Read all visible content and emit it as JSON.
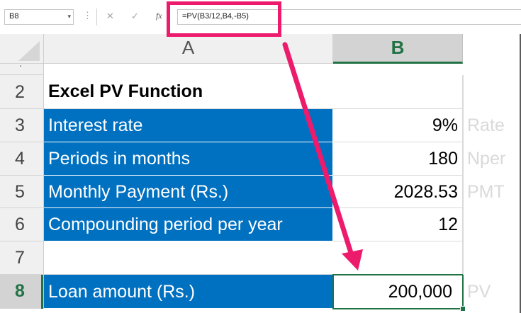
{
  "formula_bar": {
    "name_box": "B8",
    "name_box_dropdown": "▾",
    "more_icon": "⋮",
    "cancel_icon": "✕",
    "enter_icon": "✓",
    "fx_icon": "fx",
    "formula": "=PV(B3/12,B4,-B5)"
  },
  "columns": [
    "A",
    "B"
  ],
  "rows": [
    {
      "num": "2",
      "a": "Excel PV Function",
      "b": "",
      "note": ""
    },
    {
      "num": "3",
      "a": "Interest rate",
      "b": "9%",
      "note": "Rate"
    },
    {
      "num": "4",
      "a": "Periods in months",
      "b": "180",
      "note": "Nper"
    },
    {
      "num": "5",
      "a": "Monthly Payment (Rs.)",
      "b": "2028.53",
      "note": "PMT"
    },
    {
      "num": "6",
      "a": "Compounding period per year",
      "b": "12",
      "note": ""
    },
    {
      "num": "7",
      "a": "",
      "b": "",
      "note": ""
    },
    {
      "num": "8",
      "a": "Loan amount (Rs.)",
      "b": "200,000",
      "note": "PV"
    }
  ],
  "colors": {
    "header_fill": "#0070c0",
    "selected_green": "#217346",
    "annotation_pink": "#ec1b6b"
  }
}
